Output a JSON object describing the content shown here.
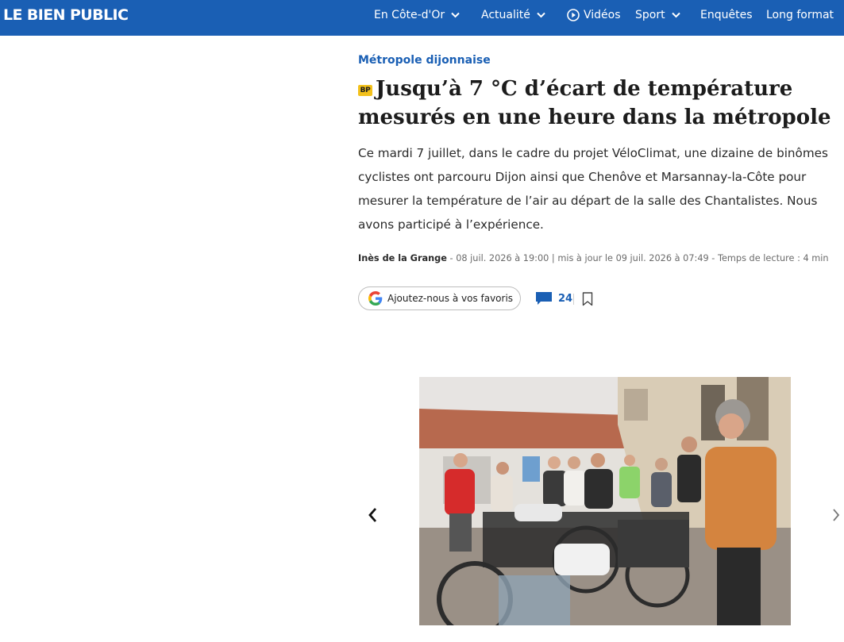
{
  "header": {
    "logo": "LE BIEN PUBLIC",
    "brand_color": "#1a5fb4",
    "nav": [
      {
        "label": "En Côte-d'Or",
        "dropdown": true
      },
      {
        "label": "Actualité",
        "dropdown": true
      },
      {
        "label": "Vidéos",
        "icon": "play-circle-icon"
      },
      {
        "label": "Sport",
        "dropdown": true
      },
      {
        "label": "Enquêtes"
      },
      {
        "label": "Long format"
      }
    ]
  },
  "article": {
    "section": "Métropole dijonnaise",
    "badge": "BP",
    "title": "Jusqu’à 7 °C d’écart de température mesurés en une heure dans la métropole",
    "lead": "Ce mardi 7 juillet, dans le cadre du projet VéloClimat, une dizaine de binômes cyclistes ont parcouru Dijon ainsi que Chenôve et Marsannay-la-Côte pour mesurer la température de l’air au départ de la salle des Chantalistes. Nous avons participé à l’expérience.",
    "author": "Inès de la Grange",
    "meta": " - 08 juil. 2026 à 19:00 | mis à jour le 09 juil. 2026 à 07:49 - Temps de lecture : 4 min",
    "favorites_button": "Ajoutez-nous à vos favoris",
    "comment_count": "24"
  },
  "carousel": {
    "prev_icon": "chevron-left-icon",
    "next_icon": "chevron-right-icon",
    "photo": "group-of-cyclists-with-bikes"
  },
  "colors": {
    "accent": "#1a5fb4",
    "badge": "#f3c11b"
  }
}
